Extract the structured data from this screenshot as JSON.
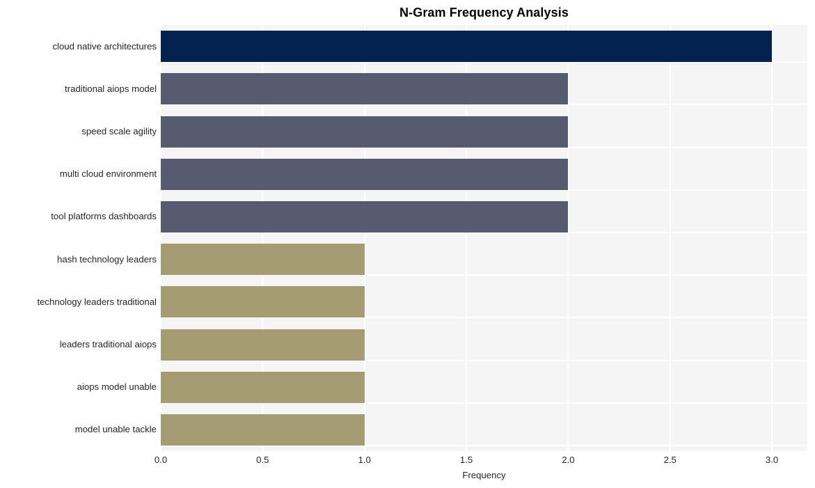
{
  "chart_data": {
    "type": "bar",
    "orientation": "horizontal",
    "title": "N-Gram Frequency Analysis",
    "xlabel": "Frequency",
    "ylabel": "",
    "categories": [
      "cloud native architectures",
      "traditional aiops model",
      "speed scale agility",
      "multi cloud environment",
      "tool platforms dashboards",
      "hash technology leaders",
      "technology leaders traditional",
      "leaders traditional aiops",
      "aiops model unable",
      "model unable tackle"
    ],
    "values": [
      3,
      2,
      2,
      2,
      2,
      1,
      1,
      1,
      1,
      1
    ],
    "bar_colors": [
      "#04224f",
      "#565c70",
      "#565c70",
      "#565c70",
      "#565c70",
      "#a59c73",
      "#a59c73",
      "#a59c73",
      "#a59c73",
      "#a59c73"
    ],
    "xlim": [
      0.0,
      3.1739
    ],
    "xticks": [
      0.0,
      0.5,
      1.0,
      1.5,
      2.0,
      2.5,
      3.0
    ],
    "xticklabels": [
      "0.0",
      "0.5",
      "1.0",
      "1.5",
      "2.0",
      "2.5",
      "3.0"
    ],
    "grid": true,
    "grid_color": "#ffffff",
    "plot_background": "#f5f5f5",
    "figure_background": "#ffffff",
    "legend": null
  }
}
